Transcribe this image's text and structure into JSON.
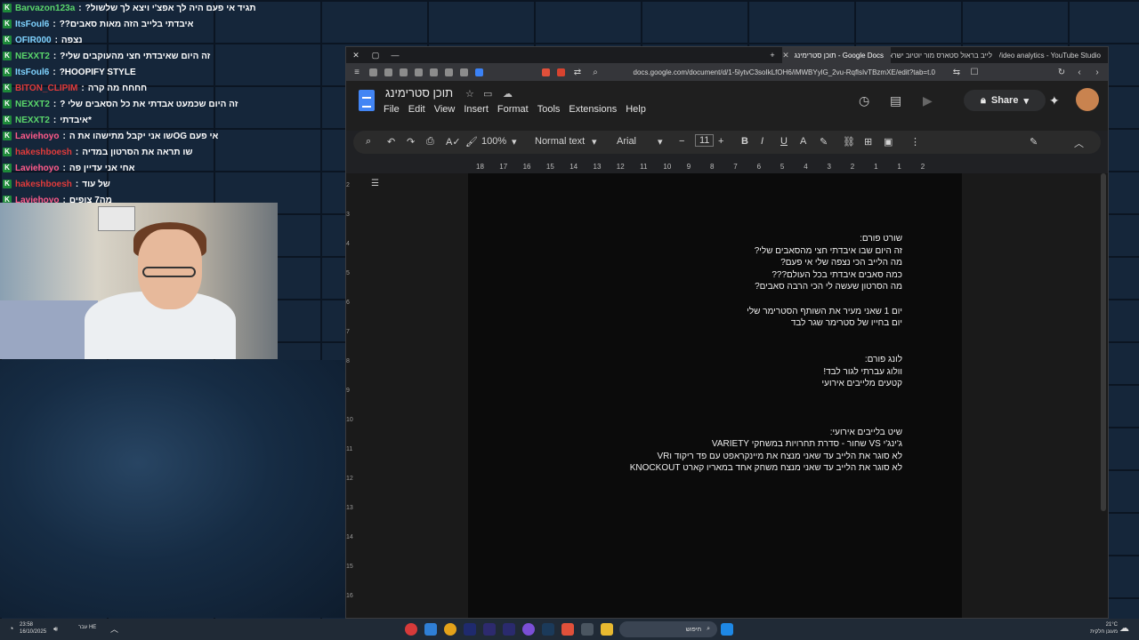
{
  "chat": [
    {
      "user": "Barvazon123a",
      "message": "תגיד אי פעם היה לך אפצ'י ויצא לך שלשול?",
      "color": "green"
    },
    {
      "user": "ItsFoul6",
      "message": "איבדתי בלייב הזה מאות סאבים??",
      "color": "blue"
    },
    {
      "user": "OFIR000",
      "message": "נצפה",
      "color": "blue"
    },
    {
      "user": "NEXXT2",
      "message": "זה היום שאיבדתי חצי מהעוקבים שלי?",
      "color": "green"
    },
    {
      "user": "ItsFoul6",
      "message": "HOOPIFY STYLE?",
      "color": "blue"
    },
    {
      "user": "BITON_CLIPIM",
      "message": "חחחח מה קרה",
      "color": "red"
    },
    {
      "user": "NEXXT2",
      "message": "זה היום שכמעט אבדתי את כל הסאבים שלי ?",
      "color": "green"
    },
    {
      "user": "NEXXT2",
      "message": "*איבדתי",
      "color": "green"
    },
    {
      "user": "Laviehoyo",
      "message": "אי פעם OGשו אני יקבל מתישהו את ה",
      "color": "pink"
    },
    {
      "user": "hakeshboesh",
      "message": "שו תראה את הסרטון במדיה",
      "color": "red"
    },
    {
      "user": "Laviehoyo",
      "message": "אחי אני עדיין פה",
      "color": "pink"
    },
    {
      "user": "hakeshboesh",
      "message": "של עוד",
      "color": "red"
    },
    {
      "user": "Laviehoyo",
      "message": "מה7 צופים",
      "color": "pink"
    }
  ],
  "browser": {
    "tabs": [
      {
        "label": "תוכן סטרימינג - Google Docs",
        "active": true
      },
      {
        "label": "לייב בראול סטארס מור יוטיוב ישראל",
        "active": false
      },
      {
        "label": "Video analytics - YouTube Studio",
        "active": false
      }
    ],
    "url": "docs.google.com/document/d/1-5lytvC3soIkLfOH6/iMWBYylG_2vu-RqflsIvTBzmXE/edit?tab=t.0"
  },
  "docs": {
    "title": "תוכן סטרימינג",
    "menu": [
      "File",
      "Edit",
      "View",
      "Insert",
      "Format",
      "Tools",
      "Extensions",
      "Help"
    ],
    "share_label": "Share",
    "zoom": "100%",
    "style": "Normal text",
    "font": "Arial",
    "font_size": "11",
    "ruler_ticks": [
      "18",
      "17",
      "16",
      "15",
      "14",
      "13",
      "12",
      "11",
      "10",
      "9",
      "8",
      "7",
      "6",
      "5",
      "4",
      "3",
      "2",
      "1",
      "1",
      "2"
    ],
    "vruler_ticks": [
      "2",
      "3",
      "4",
      "5",
      "6",
      "7",
      "8",
      "9",
      "10",
      "11",
      "12",
      "13",
      "14",
      "15",
      "16"
    ],
    "content": [
      "שורט פורם:",
      "זה היום שבו איבדתי חצי מהסאבים שלי?",
      "מה הלייב הכי נצפה שלי אי פעם?",
      "כמה סאבים איבדתי בכל העולם???",
      "מה הסרטון שעשה לי הכי הרבה סאבים?",
      "",
      "יום 1 שאני מעיר את השותף הסטרימר שלי",
      "יום בחייו של סטרימר שגר לבד",
      "",
      "",
      "לונג פורם:",
      "וולוג עברתי לגור לבד!",
      "קטעים מלייבים אירועי",
      "",
      "",
      "",
      "שיט בלייבים אירועי:",
      "ג'ינג'י VS שחור - סדרת תחרויות במשחקי VARIETY",
      "לא סוגר את הלייב עד שאני מנצח את מיינקראפט עם פד ריקוד וVR",
      "לא סוגר את הלייב עד שאני מנצח משחק אחד במאריו קארט KNOCKOUT"
    ]
  },
  "taskbar": {
    "time": "23:58",
    "date": "16/10/2025",
    "lang": "עבר HE",
    "search_placeholder": "חיפוש",
    "weather_temp": "21°C",
    "weather_desc": "מעונן חלקית"
  }
}
